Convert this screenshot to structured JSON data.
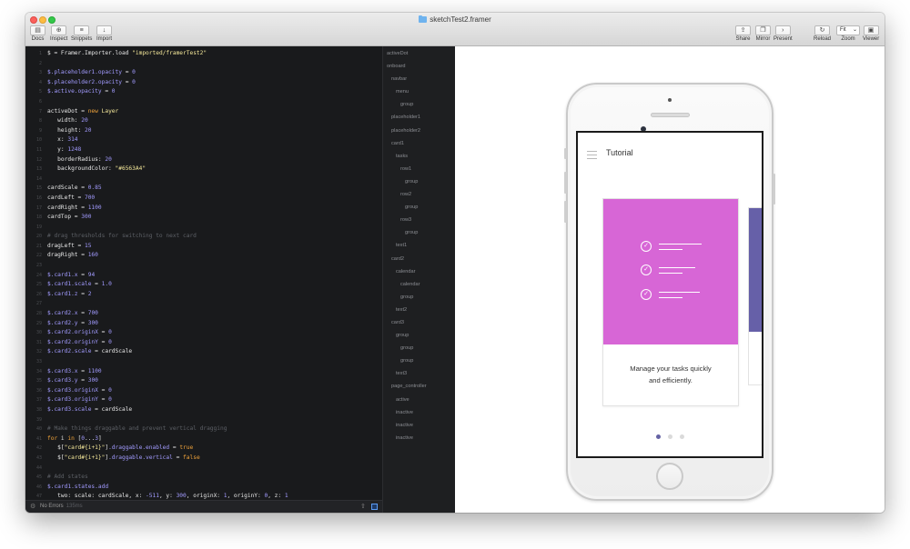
{
  "window": {
    "title": "sketchTest2.framer"
  },
  "toolbar": {
    "left": [
      {
        "label": "Docs",
        "icon": "book-icon",
        "glyph": "▤"
      },
      {
        "label": "Inspect",
        "icon": "crosshair-icon",
        "glyph": "⊕"
      },
      {
        "label": "Snippets",
        "icon": "snippets-icon",
        "glyph": "≡"
      },
      {
        "label": "Import",
        "icon": "import-icon",
        "glyph": "↓"
      }
    ],
    "right": [
      {
        "label": "Share",
        "icon": "share-icon",
        "glyph": "⇪"
      },
      {
        "label": "Mirror",
        "icon": "mirror-icon",
        "glyph": "❐"
      },
      {
        "label": "Present",
        "icon": "present-icon",
        "glyph": "›"
      },
      {
        "label": "Reload",
        "icon": "reload-icon",
        "glyph": "↻"
      },
      {
        "label": "Viewer",
        "icon": "viewer-icon",
        "glyph": "▣"
      }
    ],
    "zoom": {
      "label": "Zoom",
      "value": "Fit"
    }
  },
  "editor": {
    "status": {
      "errors": "No Errors",
      "time": "135ms"
    }
  },
  "layers": [
    {
      "name": "activeDot",
      "depth": 0
    },
    {
      "name": "onboard",
      "depth": 0
    },
    {
      "name": "navbar",
      "depth": 1
    },
    {
      "name": "menu",
      "depth": 2
    },
    {
      "name": "group",
      "depth": 3
    },
    {
      "name": "placeholder1",
      "depth": 1
    },
    {
      "name": "placeholder2",
      "depth": 1
    },
    {
      "name": "card1",
      "depth": 1
    },
    {
      "name": "tasks",
      "depth": 2
    },
    {
      "name": "row1",
      "depth": 3
    },
    {
      "name": "group",
      "depth": 4
    },
    {
      "name": "row2",
      "depth": 3
    },
    {
      "name": "group",
      "depth": 4
    },
    {
      "name": "row3",
      "depth": 3
    },
    {
      "name": "group",
      "depth": 4
    },
    {
      "name": "text1",
      "depth": 2
    },
    {
      "name": "card2",
      "depth": 1
    },
    {
      "name": "calendar",
      "depth": 2
    },
    {
      "name": "calendar",
      "depth": 3
    },
    {
      "name": "group",
      "depth": 3
    },
    {
      "name": "text2",
      "depth": 2
    },
    {
      "name": "card3",
      "depth": 1
    },
    {
      "name": "group",
      "depth": 2
    },
    {
      "name": "group",
      "depth": 3
    },
    {
      "name": "group",
      "depth": 3
    },
    {
      "name": "text3",
      "depth": 2
    },
    {
      "name": "page_controller",
      "depth": 1
    },
    {
      "name": "active",
      "depth": 2
    },
    {
      "name": "inactive",
      "depth": 2
    },
    {
      "name": "inactive",
      "depth": 2
    },
    {
      "name": "inactive",
      "depth": 2
    }
  ],
  "preview": {
    "nav_title": "Tutorial",
    "card_text_line1": "Manage your tasks quickly",
    "card_text_line2": "and efficiently.",
    "card_color": "#d766d6",
    "next_card_color": "#6660a8",
    "active_dot_color": "#6563a4",
    "page_count": 3,
    "active_page": 1
  },
  "colors": {
    "purple": "#a29bff",
    "string": "#f5e89a",
    "keyword": "#f0a33a",
    "comment": "#5d6066",
    "text": "#e7e7e7"
  },
  "code_lines": [
    [
      [
        "c-white",
        "$ = Framer.Importer.load "
      ],
      [
        "c-str",
        "\"imported/framerTest2\""
      ]
    ],
    [],
    [
      [
        "c-purple",
        "$.placeholder1.opacity"
      ],
      [
        "c-white",
        " = "
      ],
      [
        "c-num",
        "0"
      ]
    ],
    [
      [
        "c-purple",
        "$.placeholder2.opacity"
      ],
      [
        "c-white",
        " = "
      ],
      [
        "c-num",
        "0"
      ]
    ],
    [
      [
        "c-purple",
        "$.active.opacity"
      ],
      [
        "c-white",
        " = "
      ],
      [
        "c-num",
        "0"
      ]
    ],
    [],
    [
      [
        "c-white",
        "activeDot = "
      ],
      [
        "c-kw",
        "new"
      ],
      [
        "c-str",
        " Layer"
      ]
    ],
    [
      [
        "c-white",
        "   width: "
      ],
      [
        "c-num",
        "20"
      ]
    ],
    [
      [
        "c-white",
        "   height: "
      ],
      [
        "c-num",
        "20"
      ]
    ],
    [
      [
        "c-white",
        "   x: "
      ],
      [
        "c-num",
        "314"
      ]
    ],
    [
      [
        "c-white",
        "   y: "
      ],
      [
        "c-num",
        "1248"
      ]
    ],
    [
      [
        "c-white",
        "   borderRadius: "
      ],
      [
        "c-num",
        "20"
      ]
    ],
    [
      [
        "c-white",
        "   backgroundColor: "
      ],
      [
        "c-str",
        "\"#6563A4\""
      ]
    ],
    [],
    [
      [
        "c-white",
        "cardScale = "
      ],
      [
        "c-num",
        "0.85"
      ]
    ],
    [
      [
        "c-white",
        "cardLeft = "
      ],
      [
        "c-num",
        "700"
      ]
    ],
    [
      [
        "c-white",
        "cardRight = "
      ],
      [
        "c-num",
        "1100"
      ]
    ],
    [
      [
        "c-white",
        "cardTop = "
      ],
      [
        "c-num",
        "300"
      ]
    ],
    [],
    [
      [
        "c-cmt",
        "# drag thresholds for switching to next card"
      ]
    ],
    [
      [
        "c-white",
        "dragLeft = "
      ],
      [
        "c-num",
        "15"
      ]
    ],
    [
      [
        "c-white",
        "dragRight = "
      ],
      [
        "c-num",
        "160"
      ]
    ],
    [],
    [
      [
        "c-purple",
        "$.card1.x"
      ],
      [
        "c-white",
        " = "
      ],
      [
        "c-num",
        "94"
      ]
    ],
    [
      [
        "c-purple",
        "$.card1.scale"
      ],
      [
        "c-white",
        " = "
      ],
      [
        "c-num",
        "1.0"
      ]
    ],
    [
      [
        "c-purple",
        "$.card1.z"
      ],
      [
        "c-white",
        " = "
      ],
      [
        "c-num",
        "2"
      ]
    ],
    [],
    [
      [
        "c-purple",
        "$.card2.x"
      ],
      [
        "c-white",
        " = "
      ],
      [
        "c-num",
        "700"
      ]
    ],
    [
      [
        "c-purple",
        "$.card2.y"
      ],
      [
        "c-white",
        " = "
      ],
      [
        "c-num",
        "300"
      ]
    ],
    [
      [
        "c-purple",
        "$.card2.originX"
      ],
      [
        "c-white",
        " = "
      ],
      [
        "c-num",
        "0"
      ]
    ],
    [
      [
        "c-purple",
        "$.card2.originY"
      ],
      [
        "c-white",
        " = "
      ],
      [
        "c-num",
        "0"
      ]
    ],
    [
      [
        "c-purple",
        "$.card2.scale"
      ],
      [
        "c-white",
        " = cardScale"
      ]
    ],
    [],
    [
      [
        "c-purple",
        "$.card3.x"
      ],
      [
        "c-white",
        " = "
      ],
      [
        "c-num",
        "1100"
      ]
    ],
    [
      [
        "c-purple",
        "$.card3.y"
      ],
      [
        "c-white",
        " = "
      ],
      [
        "c-num",
        "300"
      ]
    ],
    [
      [
        "c-purple",
        "$.card3.originX"
      ],
      [
        "c-white",
        " = "
      ],
      [
        "c-num",
        "0"
      ]
    ],
    [
      [
        "c-purple",
        "$.card3.originY"
      ],
      [
        "c-white",
        " = "
      ],
      [
        "c-num",
        "0"
      ]
    ],
    [
      [
        "c-purple",
        "$.card3.scale"
      ],
      [
        "c-white",
        " = cardScale"
      ]
    ],
    [],
    [
      [
        "c-cmt",
        "# Make things draggable and prevent vertical dragging"
      ]
    ],
    [
      [
        "c-kw",
        "for"
      ],
      [
        "c-white",
        " i "
      ],
      [
        "c-kw",
        "in"
      ],
      [
        "c-white",
        " ["
      ],
      [
        "c-num",
        "0"
      ],
      [
        "c-white",
        "..."
      ],
      [
        "c-num",
        "3"
      ],
      [
        "c-white",
        "]"
      ]
    ],
    [
      [
        "c-white",
        "   $["
      ],
      [
        "c-str",
        "\"card#{i+1}\""
      ],
      [
        "c-white",
        "]"
      ],
      [
        "c-purple",
        ".draggable.enabled"
      ],
      [
        "c-white",
        " = "
      ],
      [
        "c-kw",
        "true"
      ]
    ],
    [
      [
        "c-white",
        "   $["
      ],
      [
        "c-str",
        "\"card#{i+1}\""
      ],
      [
        "c-white",
        "]"
      ],
      [
        "c-purple",
        ".draggable.vertical"
      ],
      [
        "c-white",
        " = "
      ],
      [
        "c-kw",
        "false"
      ]
    ],
    [],
    [
      [
        "c-cmt",
        "# Add states"
      ]
    ],
    [
      [
        "c-purple",
        "$.card1.states.add"
      ]
    ],
    [
      [
        "c-white",
        "   two: scale: cardScale, x: "
      ],
      [
        "c-num",
        "-511"
      ],
      [
        "c-white",
        ", y: "
      ],
      [
        "c-num",
        "300"
      ],
      [
        "c-white",
        ", originX: "
      ],
      [
        "c-num",
        "1"
      ],
      [
        "c-white",
        ", originY: "
      ],
      [
        "c-num",
        "0"
      ],
      [
        "c-white",
        ", z: "
      ],
      [
        "c-num",
        "1"
      ]
    ]
  ]
}
